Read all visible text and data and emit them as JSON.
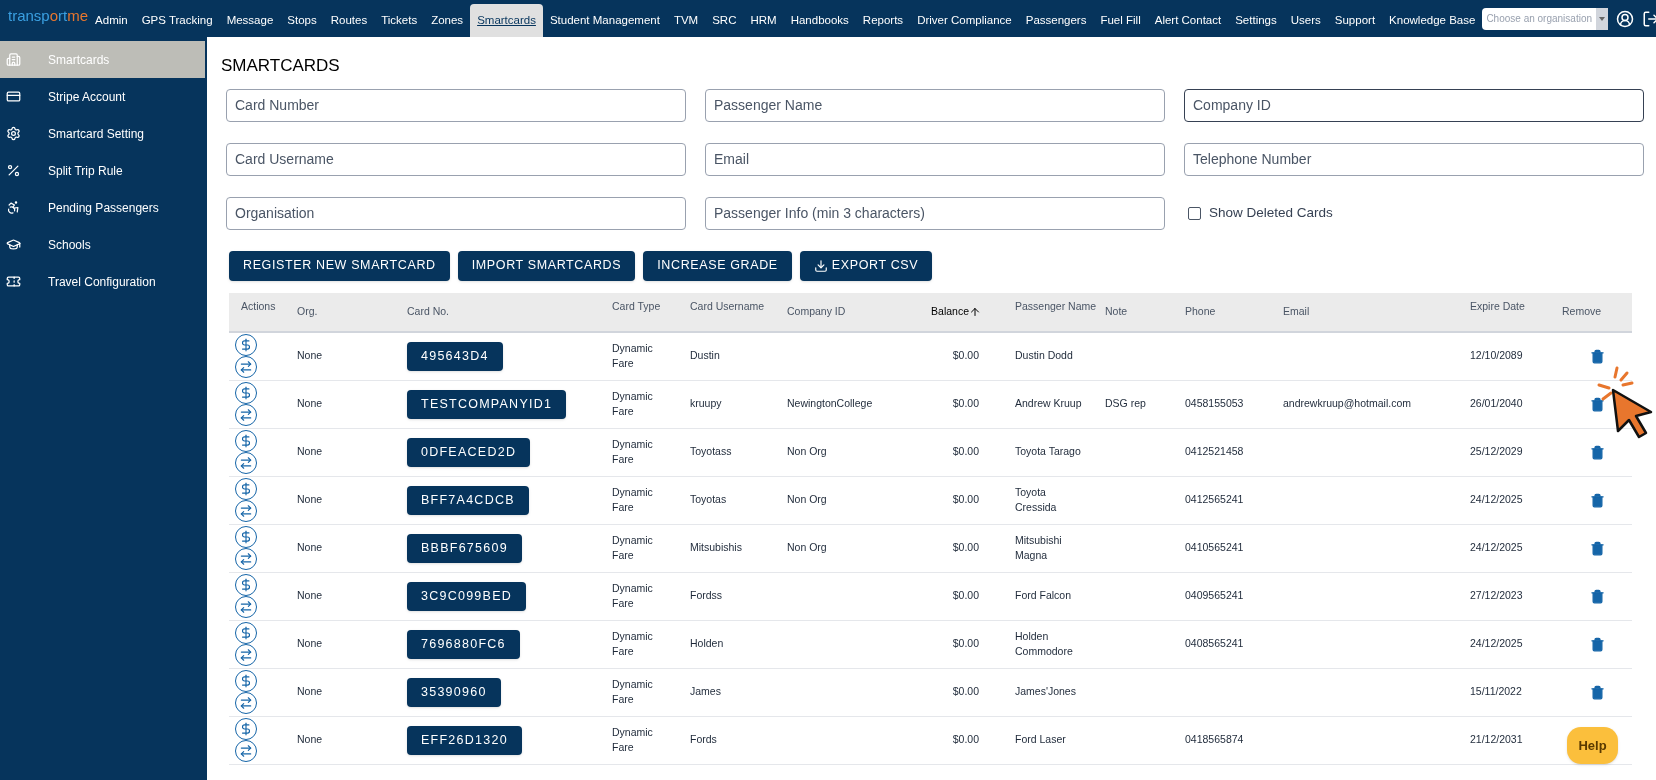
{
  "logo": {
    "part1": "transp",
    "mark": "o",
    "part2": "rt",
    "part3": "me"
  },
  "nav": [
    {
      "label": "Admin",
      "selected": false
    },
    {
      "label": "GPS Tracking",
      "selected": false
    },
    {
      "label": "Message",
      "selected": false
    },
    {
      "label": "Stops",
      "selected": false
    },
    {
      "label": "Routes",
      "selected": false
    },
    {
      "label": "Tickets",
      "selected": false
    },
    {
      "label": "Zones",
      "selected": false
    },
    {
      "label": "Smartcards",
      "selected": true
    },
    {
      "label": "Student Management",
      "selected": false
    },
    {
      "label": "TVM",
      "selected": false
    },
    {
      "label": "SRC",
      "selected": false
    },
    {
      "label": "HRM",
      "selected": false
    },
    {
      "label": "Handbooks",
      "selected": false
    },
    {
      "label": "Reports",
      "selected": false
    },
    {
      "label": "Driver Compliance",
      "selected": false
    },
    {
      "label": "Passengers",
      "selected": false
    },
    {
      "label": "Fuel Fill",
      "selected": false
    },
    {
      "label": "Alert Contact",
      "selected": false
    },
    {
      "label": "Settings",
      "selected": false
    },
    {
      "label": "Users",
      "selected": false
    },
    {
      "label": "Support",
      "selected": false
    },
    {
      "label": "Knowledge Base",
      "selected": false
    }
  ],
  "org_select": {
    "placeholder": "Choose an organisation"
  },
  "sidebar": {
    "items": [
      {
        "label": "Smartcards",
        "selected": true
      },
      {
        "label": "Stripe Account",
        "selected": false
      },
      {
        "label": "Smartcard Setting",
        "selected": false
      },
      {
        "label": "Split Trip Rule",
        "selected": false
      },
      {
        "label": "Pending Passengers",
        "selected": false
      },
      {
        "label": "Schools",
        "selected": false
      },
      {
        "label": "Travel Configuration",
        "selected": false
      }
    ]
  },
  "page_title": "SMARTCARDS",
  "filters": [
    {
      "placeholder": "Card Number",
      "focused": false
    },
    {
      "placeholder": "Passenger Name",
      "focused": false
    },
    {
      "placeholder": "Company ID",
      "focused": true
    },
    {
      "placeholder": "Card Username",
      "focused": false
    },
    {
      "placeholder": "Email",
      "focused": false
    },
    {
      "placeholder": "Telephone Number",
      "focused": false
    },
    {
      "placeholder": "Organisation",
      "focused": false
    },
    {
      "placeholder": "Passenger Info (min 3 characters)",
      "focused": false
    }
  ],
  "show_deleted": {
    "label": "Show Deleted Cards",
    "checked": false
  },
  "buttons": [
    {
      "label": "REGISTER NEW SMARTCARD",
      "kind": "plain"
    },
    {
      "label": "IMPORT SMARTCARDS",
      "kind": "plain"
    },
    {
      "label": "INCREASE GRADE",
      "kind": "plain"
    },
    {
      "label": "EXPORT CSV",
      "kind": "download"
    }
  ],
  "table": {
    "columns": [
      {
        "label": "Actions",
        "sorted": false
      },
      {
        "label": "Org.",
        "sorted": false
      },
      {
        "label": "Card No.",
        "sorted": false
      },
      {
        "label": "Card Type",
        "sorted": false
      },
      {
        "label": "Card Username",
        "sorted": false
      },
      {
        "label": "Company ID",
        "sorted": false
      },
      {
        "label": "Balance",
        "sorted": true
      },
      {
        "label": "Passenger Name",
        "sorted": false
      },
      {
        "label": "Note",
        "sorted": false
      },
      {
        "label": "Phone",
        "sorted": false
      },
      {
        "label": "Email",
        "sorted": false
      },
      {
        "label": "Expire Date",
        "sorted": false
      },
      {
        "label": "Remove",
        "sorted": false
      }
    ],
    "rows": [
      {
        "org": "None",
        "card_no": "495643D4",
        "card_type": "Dynamic Fare",
        "username": "Dustin",
        "company_id": "",
        "balance": "$0.00",
        "passenger": "Dustin Dodd",
        "note": "",
        "phone": "",
        "email": "",
        "expire": "12/10/2089"
      },
      {
        "org": "None",
        "card_no": "TESTCOMPANYID1",
        "card_type": "Dynamic Fare",
        "username": "kruupy",
        "company_id": "NewingtonCollege",
        "balance": "$0.00",
        "passenger": "Andrew Kruup",
        "note": "DSG rep",
        "phone": "0458155053",
        "email": "andrewkruup@hotmail.com",
        "expire": "26/01/2040"
      },
      {
        "org": "None",
        "card_no": "0DFEACED2D",
        "card_type": "Dynamic Fare",
        "username": "Toyotass",
        "company_id": "Non Org",
        "balance": "$0.00",
        "passenger": "Toyota Tarago",
        "note": "",
        "phone": "0412521458",
        "email": "",
        "expire": "25/12/2029"
      },
      {
        "org": "None",
        "card_no": "BFF7A4CDCB",
        "card_type": "Dynamic Fare",
        "username": "Toyotas",
        "company_id": "Non Org",
        "balance": "$0.00",
        "passenger": "Toyota Cressida",
        "note": "",
        "phone": "0412565241",
        "email": "",
        "expire": "24/12/2025"
      },
      {
        "org": "None",
        "card_no": "BBBF675609",
        "card_type": "Dynamic Fare",
        "username": "Mitsubishis",
        "company_id": "Non Org",
        "balance": "$0.00",
        "passenger": "Mitsubishi Magna",
        "note": "",
        "phone": "0410565241",
        "email": "",
        "expire": "24/12/2025"
      },
      {
        "org": "None",
        "card_no": "3C9C099BED",
        "card_type": "Dynamic Fare",
        "username": "Fordss",
        "company_id": "",
        "balance": "$0.00",
        "passenger": "Ford Falcon",
        "note": "",
        "phone": "0409565241",
        "email": "",
        "expire": "27/12/2023"
      },
      {
        "org": "None",
        "card_no": "7696880FC6",
        "card_type": "Dynamic Fare",
        "username": "Holden",
        "company_id": "",
        "balance": "$0.00",
        "passenger": "Holden Commodore",
        "note": "",
        "phone": "0408565241",
        "email": "",
        "expire": "24/12/2025"
      },
      {
        "org": "None",
        "card_no": "35390960",
        "card_type": "Dynamic Fare",
        "username": "James",
        "company_id": "",
        "balance": "$0.00",
        "passenger": "James'Jones",
        "note": "",
        "phone": "",
        "email": "",
        "expire": "15/11/2022"
      },
      {
        "org": "None",
        "card_no": "EFF26D1320",
        "card_type": "Dynamic Fare",
        "username": "Fords",
        "company_id": "",
        "balance": "$0.00",
        "passenger": "Ford Laser",
        "note": "",
        "phone": "0418565874",
        "email": "",
        "expire": "21/12/2031"
      }
    ]
  },
  "help_button": "Help"
}
